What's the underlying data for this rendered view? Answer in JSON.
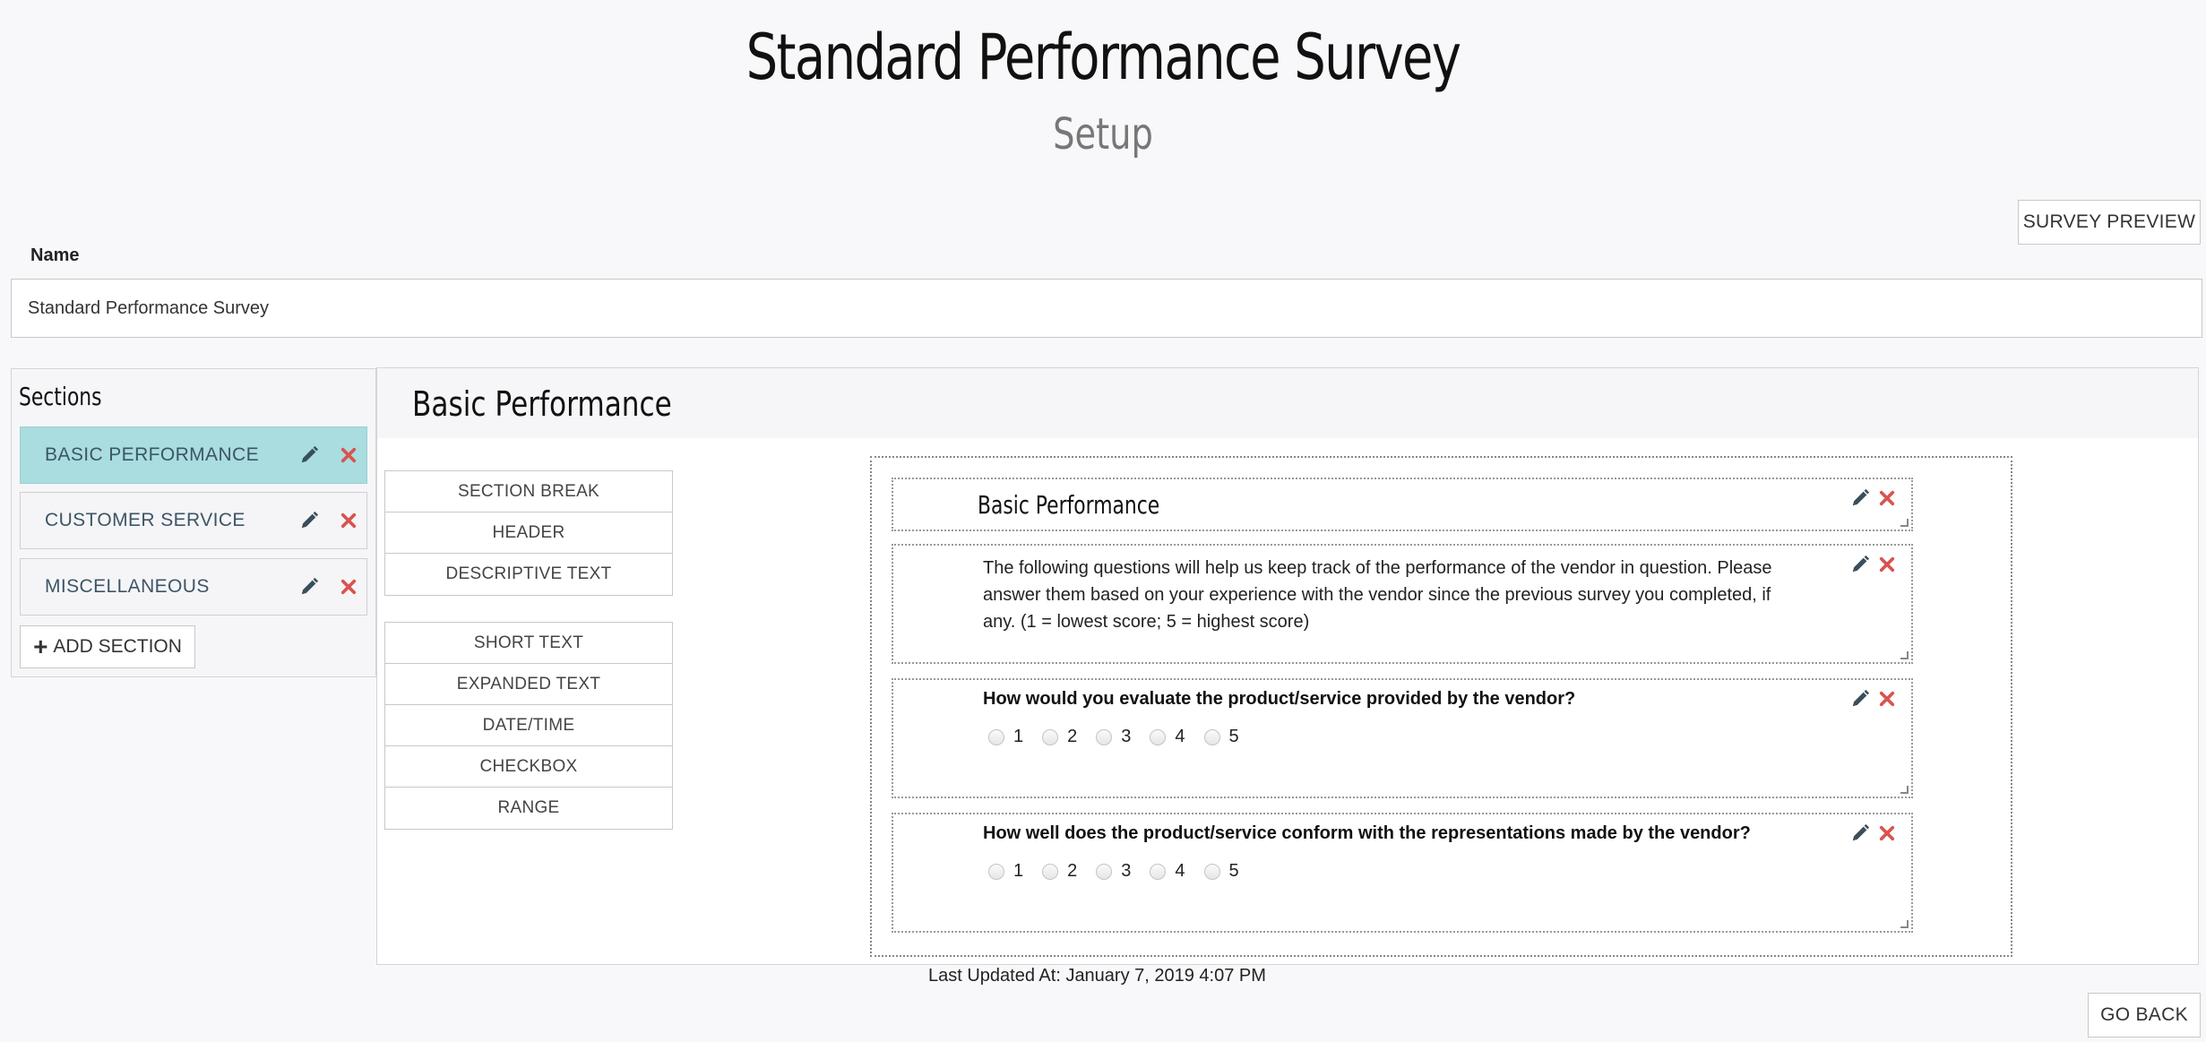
{
  "page": {
    "title": "Standard Performance Survey",
    "subtitle": "Setup",
    "preview_label": "SURVEY PREVIEW",
    "go_back_label": "GO BACK",
    "last_updated": "Last Updated At: January 7, 2019 4:07 PM"
  },
  "name_field": {
    "label": "Name",
    "value": "Standard Performance Survey"
  },
  "sections": {
    "title": "Sections",
    "items": [
      {
        "label": "BASIC PERFORMANCE",
        "active": true
      },
      {
        "label": "CUSTOMER SERVICE",
        "active": false
      },
      {
        "label": "MISCELLANEOUS",
        "active": false
      }
    ],
    "add_label": "ADD SECTION"
  },
  "main": {
    "title": "Basic Performance",
    "layout_tools": [
      "SECTION BREAK",
      "HEADER",
      "DESCRIPTIVE TEXT"
    ],
    "field_tools": [
      "SHORT TEXT",
      "EXPANDED TEXT",
      "DATE/TIME",
      "CHECKBOX",
      "RANGE"
    ],
    "cards": {
      "header": "Basic Performance",
      "description": "The following questions will help us keep track of the performance of the vendor in question. Please answer them based on your experience with the vendor since the previous survey you completed, if any. (1 = lowest score; 5 = highest score)",
      "q1": "How would you evaluate the product/service provided by the vendor?",
      "q2": "How well does the product/service conform with the representations made by the vendor?",
      "scale": [
        "1",
        "2",
        "3",
        "4",
        "5"
      ]
    }
  },
  "colors": {
    "active_section": "#a9dde0",
    "delete": "#d9534f",
    "edit": "#3a4e5c"
  },
  "icons": {
    "edit": "pencil-icon",
    "delete": "close-icon",
    "add": "plus-icon"
  }
}
